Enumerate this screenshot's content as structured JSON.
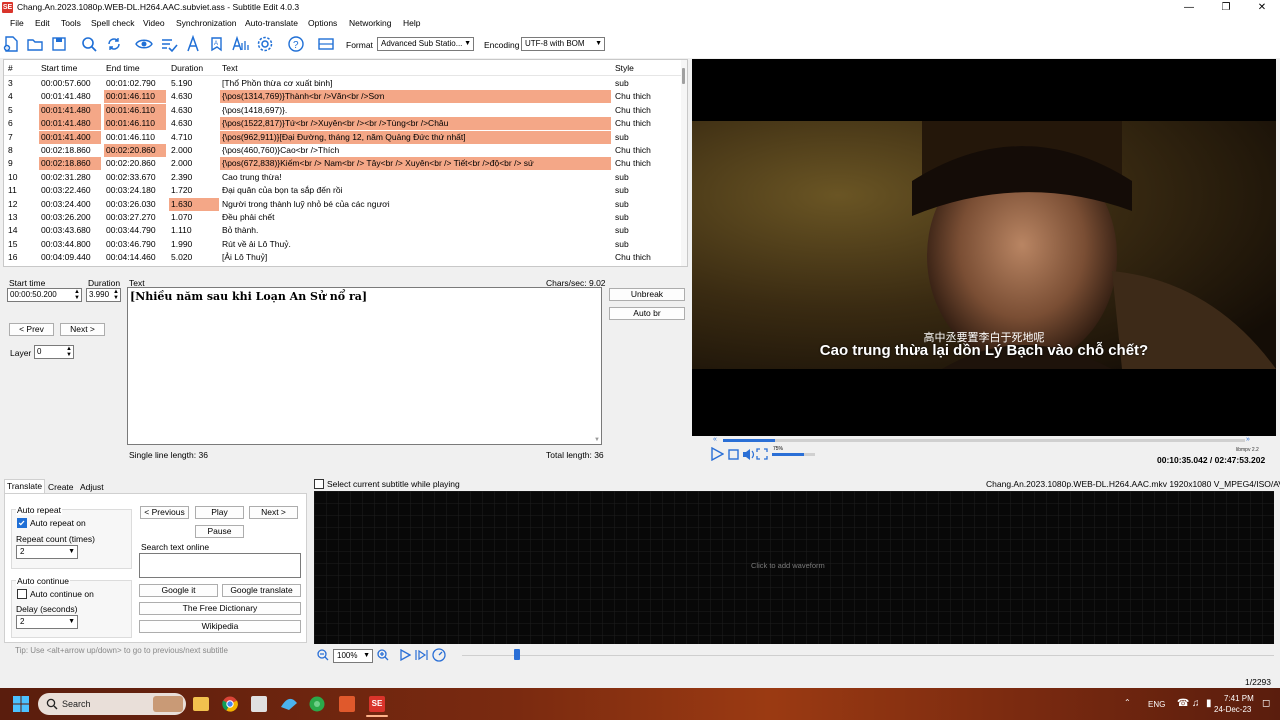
{
  "window": {
    "title": "Chang.An.2023.1080p.WEB-DL.H264.AAC.subviet.ass - Subtitle Edit 4.0.3",
    "logo_text": "SE"
  },
  "menu": [
    "File",
    "Edit",
    "Tools",
    "Spell check",
    "Video",
    "Synchronization",
    "Auto-translate",
    "Options",
    "Networking",
    "Help"
  ],
  "toolbar": {
    "format_label": "Format",
    "format_value": "Advanced Sub Statio...",
    "encoding_label": "Encoding",
    "encoding_value": "UTF-8 with BOM"
  },
  "grid": {
    "headers": [
      "#",
      "Start time",
      "End time",
      "Duration",
      "Text",
      "Style"
    ],
    "rows": [
      {
        "n": "3",
        "start": "00:00:57.600",
        "end": "00:01:02.790",
        "dur": "5.190",
        "text": "[Thổ Phồn thừa cơ xuất binh]",
        "style": "sub",
        "hs": false,
        "he": false,
        "hd": false,
        "ht": false
      },
      {
        "n": "4",
        "start": "00:01:41.480",
        "end": "00:01:46.110",
        "dur": "4.630",
        "text": "{\\pos(1314,769)}Thành<br />Văn<br />Sơn",
        "style": "Chu thich",
        "hs": false,
        "he": true,
        "hd": false,
        "ht": true
      },
      {
        "n": "5",
        "start": "00:01:41.480",
        "end": "00:01:46.110",
        "dur": "4.630",
        "text": "{\\pos(1418,697)}.",
        "style": "Chu thich",
        "hs": true,
        "he": true,
        "hd": false,
        "ht": false
      },
      {
        "n": "6",
        "start": "00:01:41.480",
        "end": "00:01:46.110",
        "dur": "4.630",
        "text": "{\\pos(1522,817)}Tứ<br />Xuyên<br /><br />Tùng<br />Châu",
        "style": "Chu thich",
        "hs": true,
        "he": true,
        "hd": false,
        "ht": true
      },
      {
        "n": "7",
        "start": "00:01:41.400",
        "end": "00:01:46.110",
        "dur": "4.710",
        "text": "{\\pos(962,911)}[Đại Đường, tháng 12, năm Quảng Đức thứ nhất]",
        "style": "sub",
        "hs": true,
        "he": false,
        "hd": false,
        "ht": true
      },
      {
        "n": "8",
        "start": "00:02:18.860",
        "end": "00:02:20.860",
        "dur": "2.000",
        "text": "{\\pos(460,760)}Cao<br />Thích",
        "style": "Chu thich",
        "hs": false,
        "he": true,
        "hd": false,
        "ht": false
      },
      {
        "n": "9",
        "start": "00:02:18.860",
        "end": "00:02:20.860",
        "dur": "2.000",
        "text": "{\\pos(672,838)}Kiếm<br /> Nam<br /> Tây<br /> Xuyên<br /> Tiết<br />độ<br /> sứ",
        "style": "Chu thich",
        "hs": true,
        "he": false,
        "hd": false,
        "ht": true
      },
      {
        "n": "10",
        "start": "00:02:31.280",
        "end": "00:02:33.670",
        "dur": "2.390",
        "text": "Cao trung thừa!",
        "style": "sub",
        "hs": false,
        "he": false,
        "hd": false,
        "ht": false
      },
      {
        "n": "11",
        "start": "00:03:22.460",
        "end": "00:03:24.180",
        "dur": "1.720",
        "text": "Đại quân của bọn ta sắp đến rồi",
        "style": "sub",
        "hs": false,
        "he": false,
        "hd": false,
        "ht": false
      },
      {
        "n": "12",
        "start": "00:03:24.400",
        "end": "00:03:26.030",
        "dur": "1.630",
        "text": "Người trong thành luỹ nhỏ bé của các ngươi",
        "style": "sub",
        "hs": false,
        "he": false,
        "hd": true,
        "ht": false
      },
      {
        "n": "13",
        "start": "00:03:26.200",
        "end": "00:03:27.270",
        "dur": "1.070",
        "text": "Đều phải chết",
        "style": "sub",
        "hs": false,
        "he": false,
        "hd": false,
        "ht": false
      },
      {
        "n": "14",
        "start": "00:03:43.680",
        "end": "00:03:44.790",
        "dur": "1.110",
        "text": "Bỏ thành.",
        "style": "sub",
        "hs": false,
        "he": false,
        "hd": false,
        "ht": false
      },
      {
        "n": "15",
        "start": "00:03:44.800",
        "end": "00:03:46.790",
        "dur": "1.990",
        "text": "Rút về ải Lô Thuỷ.",
        "style": "sub",
        "hs": false,
        "he": false,
        "hd": false,
        "ht": false
      },
      {
        "n": "16",
        "start": "00:04:09.440",
        "end": "00:04:14.460",
        "dur": "5.020",
        "text": "[Ải Lô Thuỷ]",
        "style": "Chu thich",
        "hs": false,
        "he": false,
        "hd": false,
        "ht": false
      }
    ]
  },
  "editor": {
    "start_label": "Start time",
    "start_value": "00:00:50.200",
    "duration_label": "Duration",
    "duration_value": "3.990",
    "text_label": "Text",
    "chars_sec": "Chars/sec: 9.02",
    "text_value": "[Nhiều năm sau khi Loạn An Sử nổ ra]",
    "prev": "< Prev",
    "next": "Next >",
    "layer_label": "Layer",
    "layer_value": "0",
    "unbreak": "Unbreak",
    "autobr": "Auto br",
    "single_line": "Single line length: 36",
    "total_len": "Total length: 36"
  },
  "video": {
    "sub_zh": "高中丞要置李白于死地呢",
    "sub_vi": "Cao trung thừa lại dồn Lý Bạch vào chỗ chết?",
    "time": "00:10:35.042 / 02:47:53.202",
    "volume": "75%",
    "ilibmpv": "libmpv 2.2",
    "progress": 0.1,
    "volume_level": 0.75
  },
  "tabs": [
    "Translate",
    "Create",
    "Adjust"
  ],
  "translate": {
    "auto_repeat": "Auto repeat",
    "auto_repeat_on": "Auto repeat on",
    "repeat_count_label": "Repeat count (times)",
    "repeat_count": "2",
    "auto_continue": "Auto continue",
    "auto_continue_on": "Auto continue on",
    "delay_label": "Delay (seconds)",
    "delay": "2",
    "previous": "< Previous",
    "play": "Play",
    "next": "Next >",
    "pause": "Pause",
    "search_online": "Search text online",
    "google_it": "Google it",
    "google_translate": "Google translate",
    "free_dict": "The Free Dictionary",
    "wikipedia": "Wikipedia",
    "tip": "Tip: Use <alt+arrow up/down> to go to previous/next subtitle"
  },
  "waveform": {
    "select_label": "Select current subtitle while playing",
    "fileinfo": "Chang.An.2023.1080p.WEB-DL.H264.AAC.mkv 1920x1080 V_MPEG4/ISO/AVC 25.0",
    "click_text": "Click to add waveform",
    "zoom": "100%"
  },
  "status": {
    "count": "1/2293"
  },
  "taskbar": {
    "search": "Search",
    "lang": "ENG",
    "time": "7:41 PM",
    "date": "24-Dec-23"
  },
  "colors": {
    "highlight": "#f4a787",
    "accent": "#1f6fd6",
    "taskbar": "#7a2a10"
  }
}
